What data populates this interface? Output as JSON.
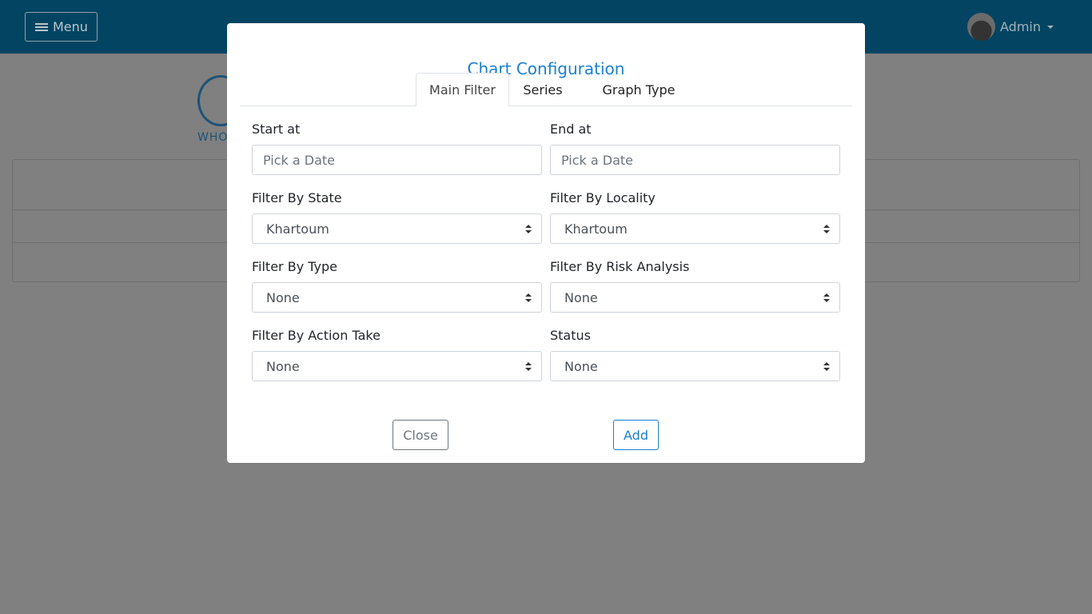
{
  "navbar": {
    "menu_label": "Menu",
    "user_label": "Admin"
  },
  "logo": {
    "text": "WHO"
  },
  "modal": {
    "title": "Chart Configuration",
    "tabs": [
      {
        "label": "Main Filter",
        "active": true
      },
      {
        "label": "Series",
        "active": false
      },
      {
        "label": "Graph Type",
        "active": false
      }
    ],
    "fields": {
      "start_at": {
        "label": "Start at",
        "placeholder": "Pick a Date"
      },
      "end_at": {
        "label": "End at",
        "placeholder": "Pick a Date"
      },
      "state": {
        "label": "Filter By State",
        "value": "Khartoum"
      },
      "locality": {
        "label": "Filter By Locality",
        "value": "Khartoum"
      },
      "type": {
        "label": "Filter By Type",
        "value": "None"
      },
      "risk": {
        "label": "Filter By Risk Analysis",
        "value": "None"
      },
      "action": {
        "label": "Filter By Action Take",
        "value": "None"
      },
      "status": {
        "label": "Status",
        "value": "None"
      }
    },
    "buttons": {
      "close": "Close",
      "add": "Add"
    }
  },
  "colors": {
    "navbar": "#024461",
    "accent": "#1a7fd0",
    "overlay": "#808080"
  }
}
